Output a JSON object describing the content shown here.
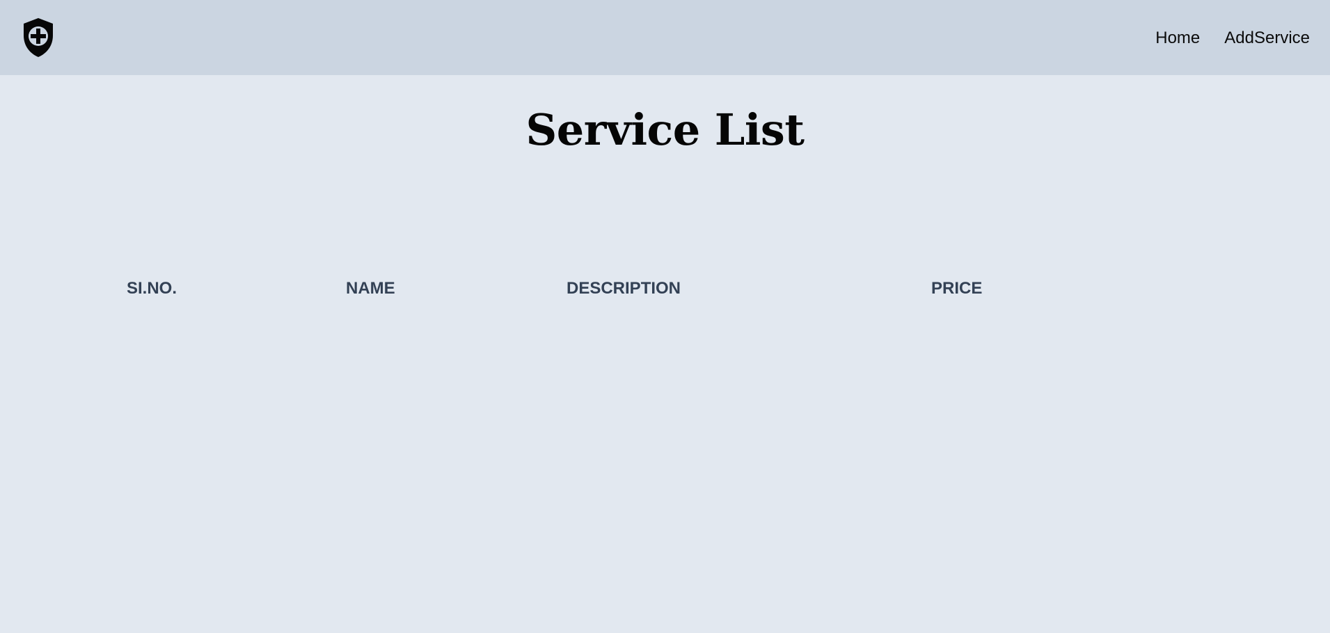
{
  "navbar": {
    "logo_icon": "shield-plus-icon",
    "links": [
      {
        "label": "Home"
      },
      {
        "label": "AddService"
      }
    ]
  },
  "page": {
    "title": "Service List"
  },
  "table": {
    "headers": [
      "SI.NO.",
      "NAME",
      "DESCRIPTION",
      "PRICE"
    ],
    "rows": []
  },
  "colors": {
    "navbar_bg": "#cbd5e1",
    "page_bg": "#e2e8f0",
    "header_text": "#334155",
    "title_text": "#050505"
  }
}
